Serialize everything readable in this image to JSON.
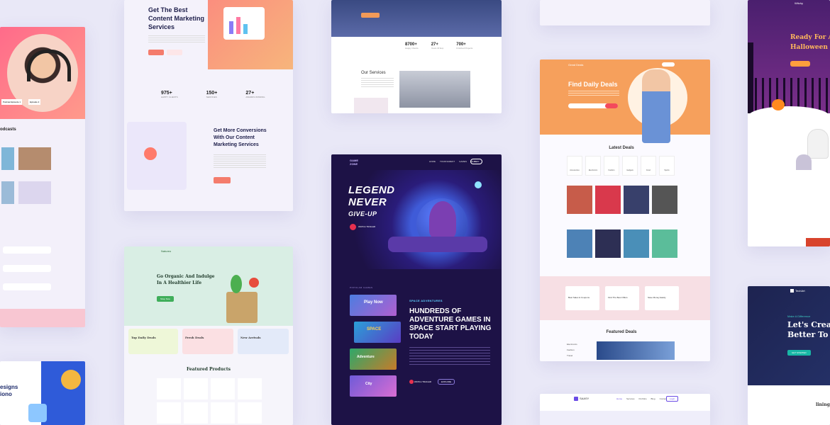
{
  "podcast": {
    "section_title": "odcasts",
    "episode_labels": [
      "Podcast Episode 1",
      "Episode 2"
    ]
  },
  "content_marketing": {
    "hero_title_l1": "Get The Best",
    "hero_title_l2": "Content Marketing",
    "hero_title_l3": "Services",
    "stats": [
      {
        "value": "975+",
        "label": "HAPPY CLIENTS"
      },
      {
        "value": "150+",
        "label": "SERVICES"
      },
      {
        "value": "27+",
        "label": "AWARDS WINNING"
      }
    ],
    "section2_l1": "Get More Conversions",
    "section2_l2": "With Our Content",
    "section2_l3": "Marketing Services"
  },
  "interior": {
    "stats": [
      {
        "value": "8700+",
        "label": "Happy Clients"
      },
      {
        "value": "27+",
        "label": "Years Of Exp"
      },
      {
        "value": "700+",
        "label": "Finished Projects"
      }
    ],
    "services_title": "Our Services"
  },
  "deals": {
    "brand": "Great Deals",
    "hero_title": "Find Daily Deals",
    "latest_title": "Latest Deals",
    "featured_title": "Featured Deals",
    "categories": [
      "Accessories",
      "Electronics",
      "Fashion",
      "Gadgets",
      "Food",
      "Sports"
    ],
    "promo_cards": [
      "Best Sales & Coupons",
      "Find The Best Offers",
      "Save Money Easily"
    ],
    "featured_filters": [
      "Electronics",
      "Fashion",
      "Travel"
    ]
  },
  "halloween": {
    "brand": "Witchy",
    "title_l1": "Ready For A",
    "title_l2": "Halloween P"
  },
  "organic": {
    "brand": "Natureo",
    "hero_l1": "Go Organic And Indulge",
    "hero_l2": "In A Healthier Life",
    "promo": [
      "Top Daily Deals",
      "Fresh Deals",
      "New Arrivals"
    ],
    "featured_title": "Featured Products",
    "shop_button": "Shop Now"
  },
  "gaming": {
    "logo_l1": "GAME",
    "logo_l2": "ZONE",
    "nav": [
      "HOME",
      "TOURNAMENT",
      "GAMES",
      "BLOG"
    ],
    "nav_button": "PLAY",
    "hero_l1": "LEGEND",
    "hero_l2": "NEVER",
    "hero_l3": "GIVE-UP",
    "watch_trailer": "WATCH TRAILER",
    "games_section_label": "POPULAR GAMES",
    "tag": "SPACE ADVENTURES",
    "headline_l1": "HUNDREDS OF",
    "headline_l2": "ADVENTURE GAMES IN",
    "headline_l3": "SPACE START PLAYING",
    "headline_l4": "TODAY",
    "cta_primary": "WATCH TRAILER",
    "cta_secondary": "EXPLORE",
    "thumbnails": [
      "Play Now",
      "SPACE",
      "Adventure",
      "City"
    ]
  },
  "design": {
    "title_l1": "esigns",
    "title_l2": "iono"
  },
  "business": {
    "brand": "TechArt",
    "eyebrow": "Make A Difference",
    "title_l1": "Let's Crea",
    "title_l2": "Better To",
    "button": "GET STARTED",
    "lining_text": "lining"
  },
  "saas": {
    "brand": "SAASY",
    "nav": [
      "Home",
      "Services",
      "Portfolio",
      "Blog",
      "Contact"
    ],
    "button": "Login"
  },
  "colors": {
    "background": "#e9e8f7",
    "gaming_bg": "#1d1246",
    "deals_orange": "#f6a05c",
    "halloween_purple": "#3b1d5e",
    "business_navy": "#1e2348"
  }
}
